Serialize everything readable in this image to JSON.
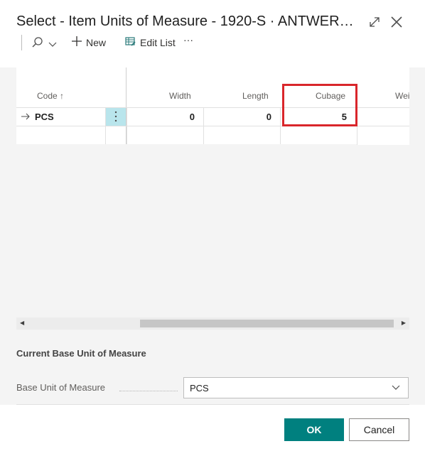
{
  "dialog": {
    "title": "Select - Item Units of Measure - 1920-S · ANTWER…"
  },
  "toolbar": {
    "new_label": "New",
    "edit_list_label": "Edit List",
    "more_label": "···"
  },
  "grid": {
    "columns": [
      "Code ↑",
      "Width",
      "Length",
      "Cubage",
      "Wei"
    ],
    "rows": [
      {
        "code": "PCS",
        "width": "0",
        "length": "0",
        "cubage": "5"
      }
    ]
  },
  "section": {
    "title": "Current Base Unit of Measure",
    "field_label": "Base Unit of Measure",
    "field_value": "PCS"
  },
  "footer": {
    "ok_label": "OK",
    "cancel_label": "Cancel"
  },
  "colors": {
    "accent": "#00807f",
    "highlight": "#d9262b",
    "selected_cell": "#b9e5ec"
  }
}
